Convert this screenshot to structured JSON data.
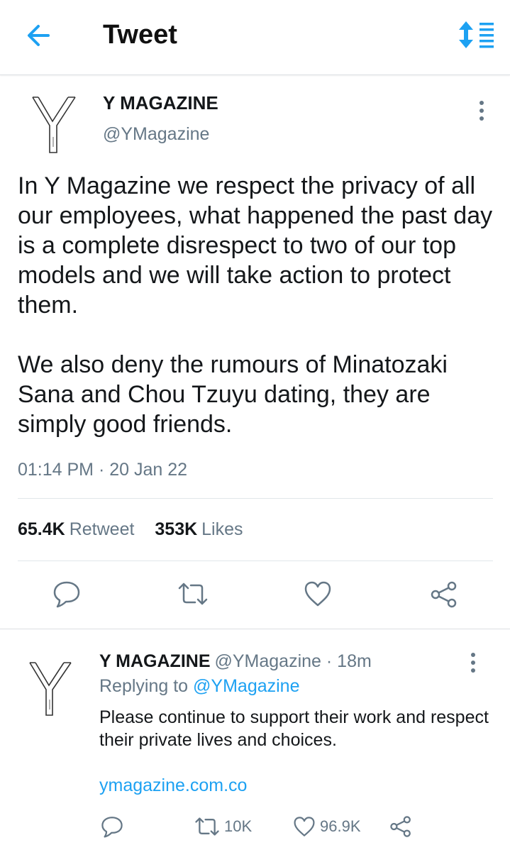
{
  "header": {
    "title": "Tweet",
    "back_icon": "arrow-left-icon",
    "sort_icon": "sort-list-icon"
  },
  "tweet": {
    "author_name": "Y MAGAZINE",
    "author_handle": "@YMagazine",
    "paragraphs": [
      "In Y Magazine we respect the privacy of all our employees, what happened the past day is a complete disrespect to two of our top models and we will take action to protect them.",
      "We also deny the rumours of Minatozaki Sana and Chou Tzuyu dating, they are simply good friends."
    ],
    "timestamp": "01:14 PM · 20 Jan 22",
    "retweet_count": "65.4K",
    "retweet_label": "Retweet",
    "likes_count": "353K",
    "likes_label": "Likes"
  },
  "reply": {
    "author_name": "Y MAGAZINE",
    "meta": "@YMagazine · 18m",
    "replying_prefix": "Replying to",
    "replying_handle": "@YMagazine",
    "text": "Please continue to support their work and respect their private lives and choices.",
    "link": "ymagazine.com.co",
    "retweet_count": "10K",
    "like_count": "96.9K"
  },
  "colors": {
    "accent": "#1da1f2",
    "muted": "#657786",
    "text": "#14171a"
  }
}
